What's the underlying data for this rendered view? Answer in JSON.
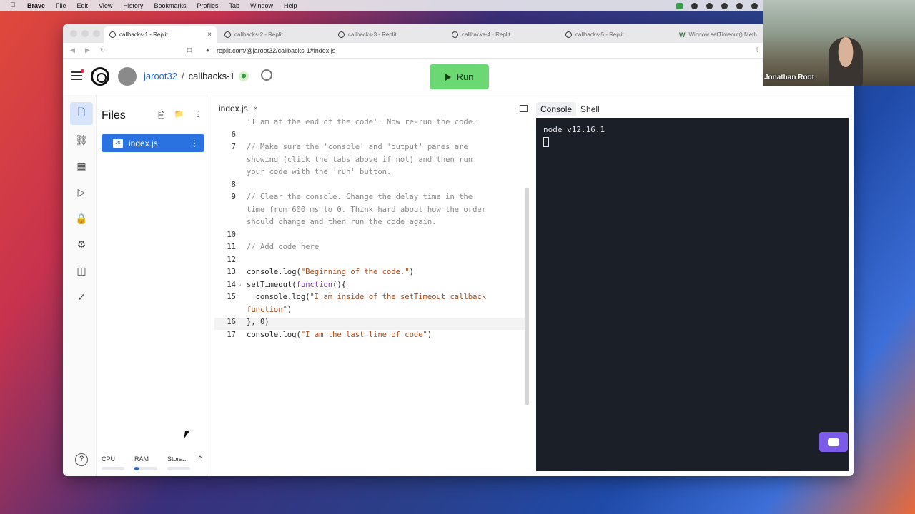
{
  "menubar": {
    "items": [
      "Brave",
      "File",
      "Edit",
      "View",
      "History",
      "Bookmarks",
      "Profiles",
      "Tab",
      "Window",
      "Help"
    ]
  },
  "video": {
    "name": "Jonathan Root"
  },
  "browser": {
    "tabs": [
      {
        "label": "callbacks-1 - Replit",
        "active": true
      },
      {
        "label": "callbacks-2 - Replit"
      },
      {
        "label": "callbacks-3 - Replit"
      },
      {
        "label": "callbacks-4 - Replit"
      },
      {
        "label": "callbacks-5 - Replit"
      },
      {
        "label": "Window setTimeout() Meth"
      }
    ],
    "url": "replit.com/@jaroot32/callbacks-1#index.js"
  },
  "replit": {
    "user": "jaroot32",
    "separator": "/",
    "project": "callbacks-1",
    "run_label": "Run"
  },
  "files": {
    "title": "Files",
    "items": [
      {
        "name": "index.js",
        "icon": "JS"
      }
    ],
    "stats": [
      {
        "label": "CPU",
        "value": 0.0
      },
      {
        "label": "RAM",
        "value": 0.15
      },
      {
        "label": "Stora...",
        "value": 0.0
      }
    ]
  },
  "editor": {
    "tab": "index.js",
    "lines": [
      {
        "n": "",
        "text": "'I am at the end of the code'. Now re-run the code."
      },
      {
        "n": "6",
        "text": ""
      },
      {
        "n": "7",
        "text": "// Make sure the 'console' and 'output' panes are"
      },
      {
        "n": "",
        "text": "showing (click the tabs above if not) and then run"
      },
      {
        "n": "",
        "text": "your code with the 'run' button."
      },
      {
        "n": "8",
        "text": ""
      },
      {
        "n": "9",
        "text": "// Clear the console. Change the delay time in the"
      },
      {
        "n": "",
        "text": "time from 600 ms to 0. Think hard about how the order"
      },
      {
        "n": "",
        "text": "should change and then run the code again."
      },
      {
        "n": "10",
        "text": ""
      },
      {
        "n": "11",
        "text": "// Add code here"
      },
      {
        "n": "12",
        "text": ""
      },
      {
        "n": "13",
        "pre": "console.log(",
        "str": "\"Beginning of the code.\"",
        "post": ")"
      },
      {
        "n": "14",
        "pre": "setTimeout(",
        "kw": "function",
        "post": "(){"
      },
      {
        "n": "15",
        "pre": "  console.log(",
        "str": "\"I am inside of the setTimeout callback",
        "post": ""
      },
      {
        "n": "",
        "pre": "",
        "str": "function\"",
        "post": ")"
      },
      {
        "n": "16",
        "pre": "}, 0)",
        "highlight": true
      },
      {
        "n": "17",
        "pre": "console.log(",
        "str": "\"I am the last line of code\"",
        "post": ")"
      }
    ]
  },
  "console": {
    "tabs": [
      "Console",
      "Shell"
    ],
    "output": "node v12.16.1"
  }
}
